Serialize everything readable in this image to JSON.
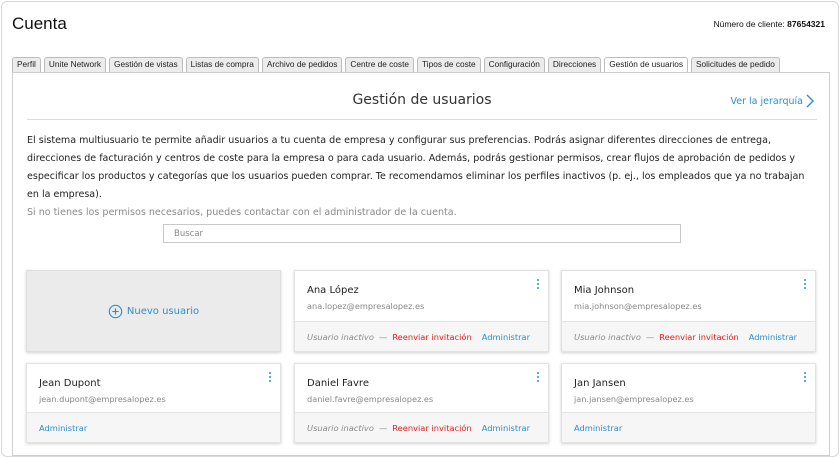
{
  "header": {
    "title": "Cuenta",
    "client_label": "Número de cliente:",
    "client_number": "87654321"
  },
  "tabs": [
    {
      "label": "Perfil"
    },
    {
      "label": "Unite Network"
    },
    {
      "label": "Gestión de vistas"
    },
    {
      "label": "Listas de compra"
    },
    {
      "label": "Archivo de pedidos"
    },
    {
      "label": "Centre de coste"
    },
    {
      "label": "Tipos de coste"
    },
    {
      "label": "Configuración"
    },
    {
      "label": "Direcciones"
    },
    {
      "label": "Gestión de usuarios",
      "active": true
    },
    {
      "label": "Solicitudes de pedido"
    }
  ],
  "section": {
    "title": "Gestión de usuarios",
    "hierarchy_link": "Ver la jerarquía",
    "intro": "El sistema multiusuario te permite añadir usuarios a tu cuenta de empresa y configurar sus preferencias. Podrás asignar diferentes direcciones de entrega, direcciones de facturación y centros de coste para la empresa o para cada usuario. Además, podrás gestionar permisos, crear flujos de aprobación de pedidos y especificar los productos y categorías que los usuarios pueden comprar. Te recomendamos eliminar los perfiles inactivos (p. ej., los empleados que ya no trabajan en la empresa).",
    "intro_note": "Si no tienes los permisos necesarios, puedes contactar con el administrador de la cuenta."
  },
  "search": {
    "placeholder": "Buscar",
    "value": ""
  },
  "new_user_label": "Nuevo usuario",
  "labels": {
    "inactive": "Usuario inactivo",
    "dash": "—",
    "resend": "Reenviar invitación",
    "manage": "Administrar"
  },
  "users": [
    {
      "name": "Ana López",
      "email": "ana.lopez@empresalopez.es",
      "inactive": true
    },
    {
      "name": "Mia Johnson",
      "email": "mia.johnson@empresalopez.es",
      "inactive": true
    },
    {
      "name": "Jean Dupont",
      "email": "jean.dupont@empresalopez.es",
      "inactive": false
    },
    {
      "name": "Daniel Favre",
      "email": "daniel.favre@empresalopez.es",
      "inactive": true
    },
    {
      "name": "Jan Jansen",
      "email": "jan.jansen@empresalopez.es",
      "inactive": false
    }
  ],
  "colors": {
    "accent": "#2a8fd1",
    "danger": "#e02020",
    "muted": "#8a8a8a"
  }
}
